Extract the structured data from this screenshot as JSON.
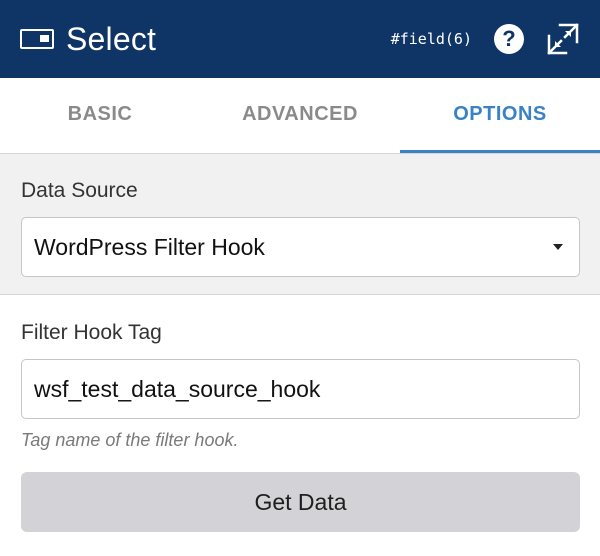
{
  "header": {
    "icon": "select-field-icon",
    "title": "Select",
    "field_id": "#field(6)",
    "help_icon": "question-mark-icon",
    "help_glyph": "?",
    "expand_icon": "expand-arrows-icon",
    "background_color": "#0e3566"
  },
  "tabs": [
    {
      "label": "BASIC",
      "active": false
    },
    {
      "label": "ADVANCED",
      "active": false
    },
    {
      "label": "OPTIONS",
      "active": true
    }
  ],
  "accent_color": "#3a82c4",
  "data_source": {
    "label": "Data Source",
    "selected": "WordPress Filter Hook",
    "dropdown_icon": "caret-down-icon"
  },
  "filter_hook": {
    "label": "Filter Hook Tag",
    "value": "wsf_test_data_source_hook",
    "help_text": "Tag name of the filter hook."
  },
  "get_data_button": {
    "label": "Get Data"
  }
}
